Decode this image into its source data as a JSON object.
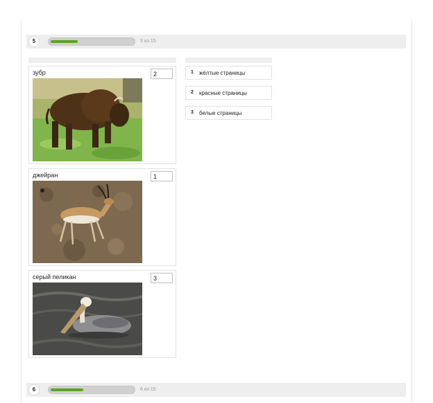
{
  "questions": [
    {
      "number": "5",
      "progress": 0.33,
      "count_label": "5 из 15"
    },
    {
      "number": "6",
      "progress": 0.4,
      "count_label": "6 из 15"
    }
  ],
  "items": [
    {
      "label": "зубр",
      "answer": "2",
      "image": "bison-photo"
    },
    {
      "label": "джейран",
      "answer": "1",
      "image": "gazelle-photo"
    },
    {
      "label": "серый пеликан",
      "answer": "3",
      "image": "pelican-photo"
    }
  ],
  "options": [
    {
      "number": "1",
      "text": "жёлтые страницы"
    },
    {
      "number": "2",
      "text": "красные страницы"
    },
    {
      "number": "3",
      "text": "белые страницы"
    }
  ],
  "colors": {
    "progress_fill": "#5aa51e",
    "bar_background": "#eeeeee"
  }
}
